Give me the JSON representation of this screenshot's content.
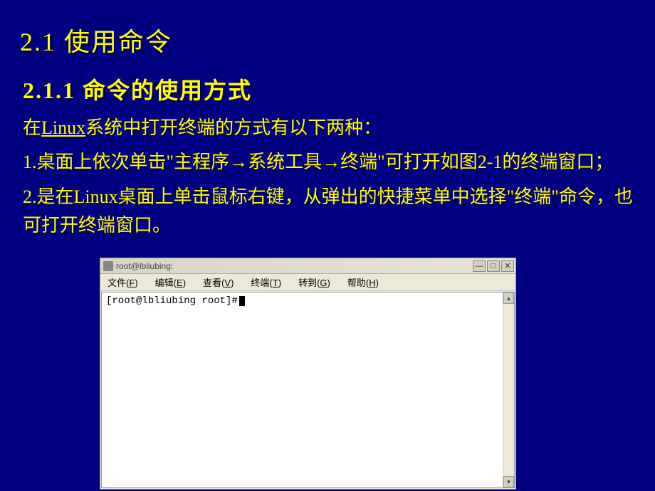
{
  "slide": {
    "section_title": "2.1  使用命令",
    "subsection_title": "2.1.1  命令的使用方式",
    "intro_prefix": "在",
    "intro_linux": "Linux",
    "intro_suffix": "系统中打开终端的方式有以下两种：",
    "item1": "1.桌面上依次单击\"主程序→系统工具→终端\"可打开如图2-1的终端窗口；",
    "item2": "2.是在Linux桌面上单击鼠标右键，从弹出的快捷菜单中选择\"终端\"命令，也可打开终端窗口。"
  },
  "terminal": {
    "title": "root@lbliubing:",
    "menu": {
      "file": "文件",
      "file_accel": "F",
      "edit": "编辑",
      "edit_accel": "E",
      "view": "查看",
      "view_accel": "V",
      "terminal": "终端",
      "terminal_accel": "T",
      "go": "转到",
      "go_accel": "G",
      "help": "帮助",
      "help_accel": "H"
    },
    "prompt": "[root@lbliubing root]# ",
    "buttons": {
      "minimize": "—",
      "maximize": "□",
      "close": "✕"
    },
    "scroll": {
      "up": "▴",
      "down": "▾"
    }
  }
}
